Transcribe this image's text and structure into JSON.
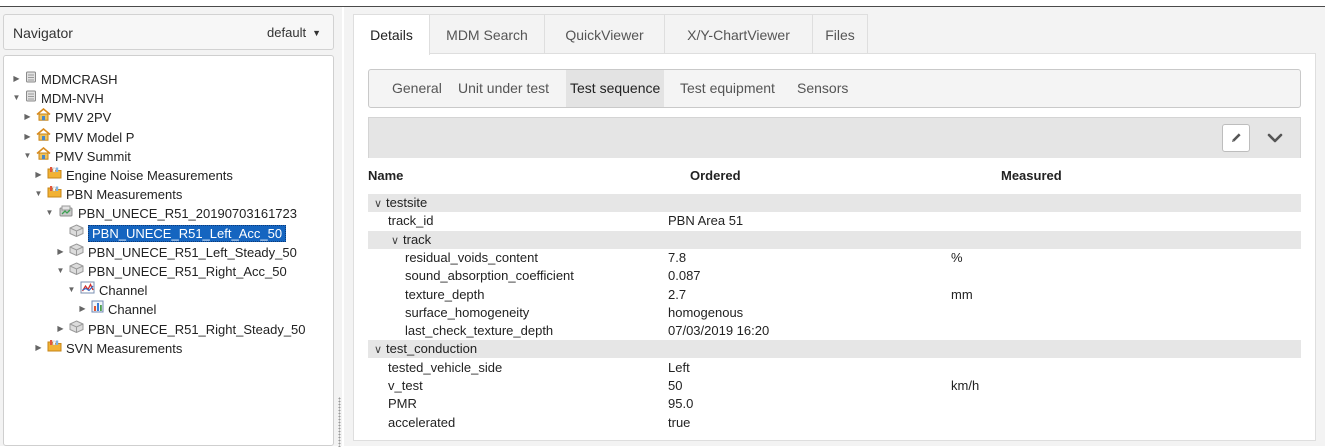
{
  "navigator": {
    "title": "Navigator",
    "selector_value": "default",
    "tree": [
      {
        "label": "MDMCRASH",
        "icon": "database-icon",
        "expanded": false
      },
      {
        "label": "MDM-NVH",
        "icon": "database-icon",
        "expanded": true
      },
      {
        "label": "PMV 2PV",
        "icon": "project-house-icon",
        "expanded": false
      },
      {
        "label": "PMV Model P",
        "icon": "project-house-icon",
        "expanded": false
      },
      {
        "label": "PMV Summit",
        "icon": "project-house-icon",
        "expanded": true
      },
      {
        "label": "Engine Noise Measurements",
        "icon": "pool-folder-icon",
        "expanded": false
      },
      {
        "label": "PBN Measurements",
        "icon": "pool-folder-icon",
        "expanded": true
      },
      {
        "label": "PBN_UNECE_R51_20190703161723",
        "icon": "test-icon",
        "expanded": true
      },
      {
        "label": "PBN_UNECE_R51_Left_Acc_50",
        "icon": "teststep-icon",
        "expanded": null,
        "selected": true
      },
      {
        "label": "PBN_UNECE_R51_Left_Steady_50",
        "icon": "teststep-icon",
        "expanded": false
      },
      {
        "label": "PBN_UNECE_R51_Right_Acc_50",
        "icon": "teststep-icon",
        "expanded": true
      },
      {
        "label": "Channel",
        "icon": "channel-group-icon",
        "expanded": true
      },
      {
        "label": "Channel",
        "icon": "channel-icon",
        "expanded": false
      },
      {
        "label": "PBN_UNECE_R51_Right_Steady_50",
        "icon": "teststep-icon",
        "expanded": false
      },
      {
        "label": "SVN Measurements",
        "icon": "pool-folder-icon",
        "expanded": false
      }
    ]
  },
  "tabs": [
    {
      "label": "Details",
      "active": true
    },
    {
      "label": "MDM Search",
      "active": false
    },
    {
      "label": "QuickViewer",
      "active": false
    },
    {
      "label": "X/Y-ChartViewer",
      "active": false
    },
    {
      "label": "Files",
      "active": false
    }
  ],
  "subtabs": [
    {
      "label": "General",
      "active": false
    },
    {
      "label": "Unit under test",
      "active": false
    },
    {
      "label": "Test sequence",
      "active": true
    },
    {
      "label": "Test equipment",
      "active": false
    },
    {
      "label": "Sensors",
      "active": false
    }
  ],
  "toolbar": {
    "edit_icon": "pencil-icon",
    "collapse_icon": "chevron-down-icon"
  },
  "grid": {
    "headers": {
      "name": "Name",
      "ordered": "Ordered",
      "measured": "Measured"
    },
    "rows": [
      {
        "type": "group",
        "name": "testsite",
        "level": 0
      },
      {
        "type": "attr",
        "name": "track_id",
        "ordered": "PBN Area 51",
        "unit": "",
        "level": 1
      },
      {
        "type": "group",
        "name": "track",
        "level": 1
      },
      {
        "type": "attr",
        "name": "residual_voids_content",
        "ordered": "7.8",
        "unit": "%",
        "level": 2
      },
      {
        "type": "attr",
        "name": "sound_absorption_coefficient",
        "ordered": "0.087",
        "unit": "",
        "level": 2
      },
      {
        "type": "attr",
        "name": "texture_depth",
        "ordered": "2.7",
        "unit": "mm",
        "level": 2
      },
      {
        "type": "attr",
        "name": "surface_homogeneity",
        "ordered": "homogenous",
        "unit": "",
        "level": 2
      },
      {
        "type": "attr",
        "name": "last_check_texture_depth",
        "ordered": "07/03/2019 16:20",
        "unit": "",
        "level": 2
      },
      {
        "type": "group",
        "name": "test_conduction",
        "level": 0
      },
      {
        "type": "attr",
        "name": "tested_vehicle_side",
        "ordered": "Left",
        "unit": "",
        "level": 1
      },
      {
        "type": "attr",
        "name": "v_test",
        "ordered": "50",
        "unit": "km/h",
        "level": 1
      },
      {
        "type": "attr",
        "name": "PMR",
        "ordered": "95.0",
        "unit": "",
        "level": 1
      },
      {
        "type": "attr",
        "name": "accelerated",
        "ordered": "true",
        "unit": "",
        "level": 1
      }
    ]
  }
}
